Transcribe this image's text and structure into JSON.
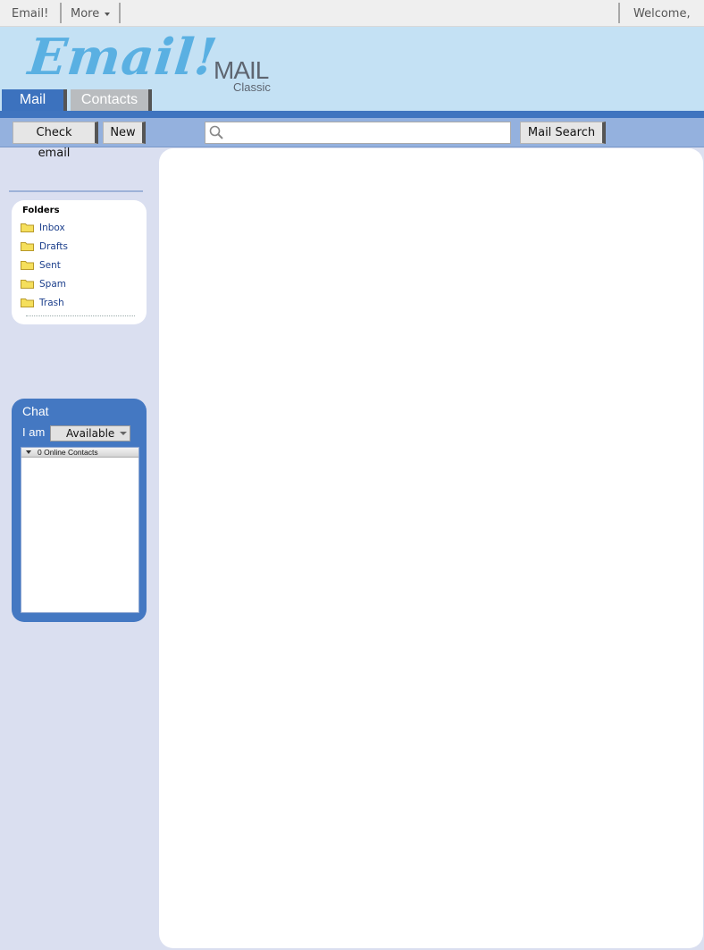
{
  "topbar": {
    "brand": "Email!",
    "more_label": "More",
    "welcome": "Welcome,"
  },
  "header": {
    "logo_text": "Email!",
    "product_name": "MAIL",
    "product_edition": "Classic"
  },
  "tabs": [
    {
      "label": "Mail",
      "active": true
    },
    {
      "label": "Contacts",
      "active": false
    }
  ],
  "toolbar": {
    "check_email_label": "Check email",
    "new_label": "New",
    "search_placeholder": "",
    "mail_search_label": "Mail Search"
  },
  "folders": {
    "title": "Folders",
    "items": [
      {
        "label": "Inbox",
        "icon": "folder-icon"
      },
      {
        "label": "Drafts",
        "icon": "folder-icon"
      },
      {
        "label": "Sent",
        "icon": "folder-icon"
      },
      {
        "label": "Spam",
        "icon": "folder-icon"
      },
      {
        "label": "Trash",
        "icon": "folder-icon"
      }
    ]
  },
  "chat": {
    "title": "Chat",
    "i_am_label": "I am",
    "status_value": "Available",
    "online_contacts": "0 Online Contacts"
  },
  "colors": {
    "header_bg": "#c4e1f4",
    "accent_blue": "#3f74bf",
    "toolbar_bg": "#94b1de",
    "sidebar_bg": "#dadff0",
    "logo_color": "#5ab0e2",
    "folder_link": "#1c3f8c"
  }
}
